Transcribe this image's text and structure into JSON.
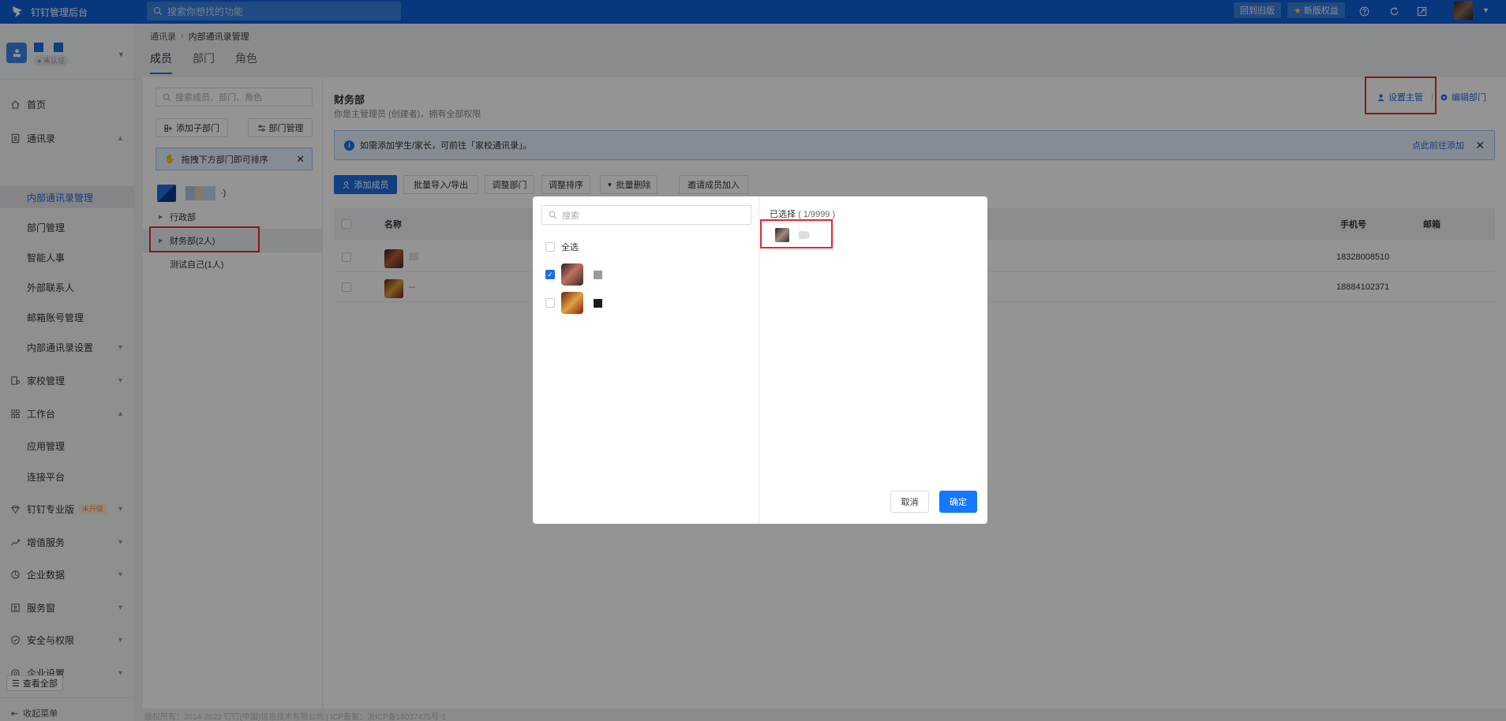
{
  "topbar": {
    "app_title": "钉钉管理后台",
    "search_placeholder": "搜索你想找的功能",
    "back_old_label": "回到旧版",
    "new_features_label": "新版权益",
    "colors": {
      "bar": "#0e5fd8"
    }
  },
  "sidebar": {
    "org_badge": "未认证",
    "items": [
      {
        "label": "首页",
        "icon": "home-icon"
      },
      {
        "label": "通讯录",
        "icon": "contacts-icon"
      },
      {
        "label": "内部通讯录管理"
      },
      {
        "label": "部门管理"
      },
      {
        "label": "智能人事"
      },
      {
        "label": "外部联系人"
      },
      {
        "label": "邮箱账号管理"
      },
      {
        "label": "内部通讯录设置"
      },
      {
        "label": "家校管理",
        "icon": "school-icon"
      },
      {
        "label": "工作台",
        "icon": "apps-icon"
      },
      {
        "label": "应用管理"
      },
      {
        "label": "连接平台"
      },
      {
        "label": "钉钉专业版",
        "icon": "diamond-icon",
        "tag": "未升级"
      },
      {
        "label": "增值服务",
        "icon": "chart-icon"
      },
      {
        "label": "企业数据",
        "icon": "data-icon"
      },
      {
        "label": "服务窗",
        "icon": "window-icon"
      },
      {
        "label": "安全与权限",
        "icon": "shield-icon"
      },
      {
        "label": "企业设置",
        "icon": "settings-icon"
      }
    ],
    "view_all": "查看全部",
    "collapse": "收起菜单"
  },
  "breadcrumb": {
    "root": "通讯录",
    "current": "内部通讯录管理"
  },
  "tabs": [
    "成员",
    "部门",
    "角色"
  ],
  "leftpanel": {
    "search_placeholder": "搜索成员、部门、角色",
    "add_sub_dept": "添加子部门",
    "dept_manage": "部门管理",
    "tip": "拖拽下方部门即可排序",
    "root_suffix": "·)",
    "nodes": [
      "行政部",
      "财务部(2人)",
      "测试自己(1人)"
    ]
  },
  "main": {
    "dept_title": "财务部",
    "dept_sub": "你是主管理员 (创建者)，拥有全部权限",
    "set_manager": "设置主管",
    "edit_dept": "编辑部门",
    "banner_text": "如需添加学生/家长，可前往「家校通讯录」。",
    "banner_link": "点此前往添加",
    "actions": [
      "添加成员",
      "批量导入/导出",
      "调整部门",
      "调整排序",
      "批量删除",
      "邀请成员加入"
    ],
    "columns": {
      "name": "名称",
      "phone": "手机号",
      "email": "邮箱"
    },
    "rows": [
      {
        "phone": "18328008510"
      },
      {
        "phone": "18884102371"
      }
    ]
  },
  "footer": "版权所有：2014-2022 钉钉(中国)信息技术有限公司 | ICP备案：浙ICP备18037475号-1",
  "modal": {
    "search_placeholder": "搜索",
    "select_all": "全选",
    "selected_label": "已选择",
    "selected_count": "( 1/9999 )",
    "cancel": "取消",
    "confirm": "确定"
  }
}
